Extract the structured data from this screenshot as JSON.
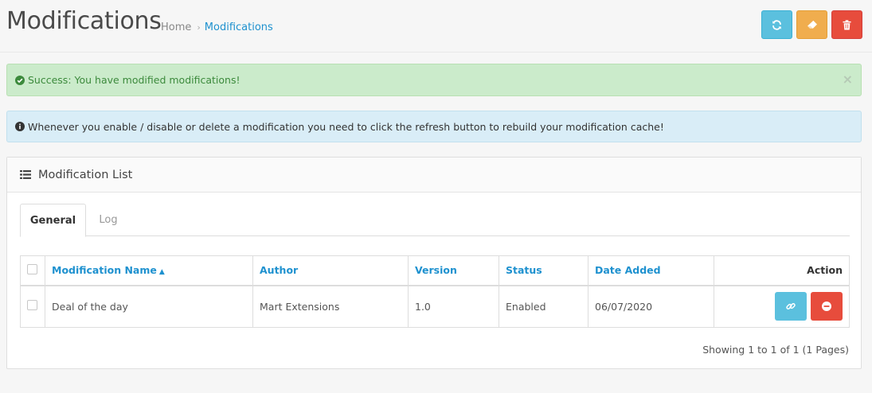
{
  "header": {
    "title": "Modifications",
    "breadcrumb": [
      {
        "label": "Home"
      },
      {
        "label": "Modifications"
      }
    ],
    "breadcrumb_sep": "›",
    "buttons": [
      {
        "name": "refresh",
        "icon": "refresh-icon",
        "color": "#5bc0de"
      },
      {
        "name": "clear",
        "icon": "eraser-icon",
        "color": "#f0ad4e"
      },
      {
        "name": "clear-log",
        "icon": "trash-icon",
        "color": "#e74c3c"
      }
    ]
  },
  "alerts": {
    "success": {
      "icon": "check-circle-icon",
      "text": "Success: You have modified modifications!",
      "close": "×"
    },
    "info": {
      "icon": "info-circle-icon",
      "text": "Whenever you enable / disable or delete a modification you need to click the refresh button to rebuild your modification cache!"
    }
  },
  "panel": {
    "icon": "list-icon",
    "title": "Modification List",
    "tabs": [
      {
        "label": "General",
        "active": true
      },
      {
        "label": "Log",
        "active": false
      }
    ],
    "table": {
      "columns": [
        "Modification Name",
        "Author",
        "Version",
        "Status",
        "Date Added",
        "Action"
      ],
      "sorted_column": "Modification Name",
      "rows": [
        {
          "name": "Deal of the day",
          "author": "Mart Extensions",
          "version": "1.0",
          "status": "Enabled",
          "date_added": "06/07/2020"
        }
      ]
    },
    "pagination_text": "Showing 1 to 1 of 1 (1 Pages)"
  },
  "colors": {
    "link": "#1e91cf",
    "info": "#5bc0de",
    "warning": "#f0ad4e",
    "danger": "#e74c3c",
    "success_bg": "#cbebcb",
    "info_bg": "#d9edf7"
  }
}
